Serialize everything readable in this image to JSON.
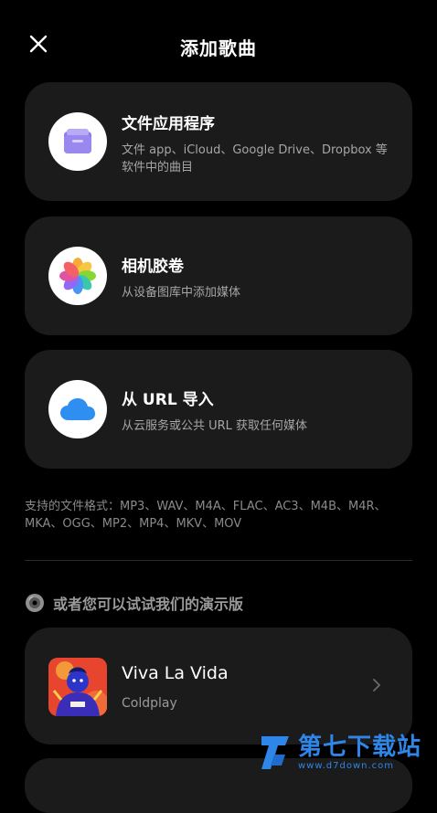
{
  "header": {
    "title": "添加歌曲"
  },
  "sources": [
    {
      "title": "文件应用程序",
      "description": "文件 app、iCloud、Google Drive、Dropbox 等软件中的曲目",
      "icon": "folder-icon"
    },
    {
      "title": "相机胶卷",
      "description": "从设备图库中添加媒体",
      "icon": "photos-icon"
    },
    {
      "title": "从 URL 导入",
      "description": "从云服务或公共 URL 获取任何媒体",
      "icon": "cloud-icon"
    }
  ],
  "formats_text": "支持的文件格式：MP3、WAV、M4A、FLAC、AC3、M4B、M4R、MKA、OGG、MP2、MP4、MKV、MOV",
  "demo": {
    "title": "或者您可以试试我们的演示版",
    "songs": [
      {
        "title": "Viva La Vida",
        "artist": "Coldplay"
      }
    ]
  },
  "watermark": {
    "name": "第七下载站",
    "url": "www.d7down.com"
  },
  "colors": {
    "background": "#000000",
    "card": "#1b1b1b",
    "accent": "#2d86e8",
    "folder": "#8e7be8",
    "cloud": "#2f8ff0"
  }
}
